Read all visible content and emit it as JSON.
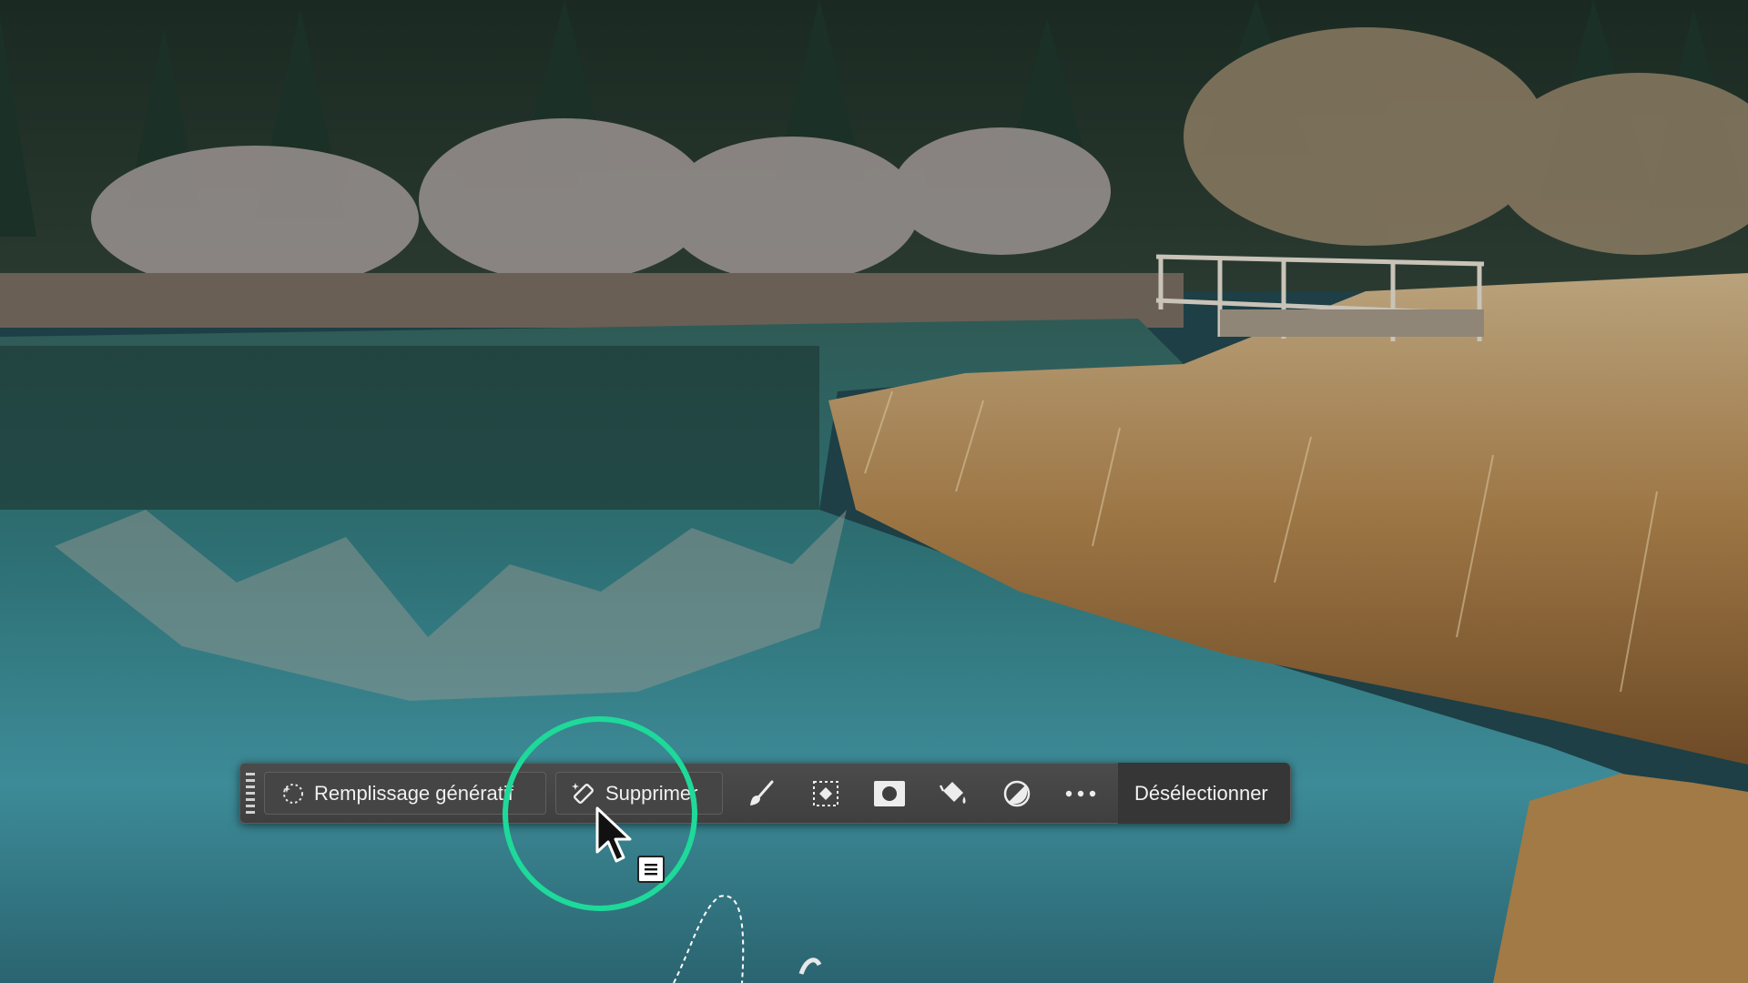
{
  "taskbar": {
    "generative_fill_label": "Remplissage génératif",
    "remove_label": "Supprimer",
    "deselect_label": "Désélectionner"
  },
  "icons": {
    "grip": "grip-handle-icon",
    "generative": "sparkle-circle-icon",
    "remove": "eraser-sparkle-icon",
    "modify": "brush-icon",
    "transform": "selection-transform-icon",
    "mask": "mask-icon",
    "fill": "paint-bucket-icon",
    "adjust": "adjustment-icon",
    "more": "more-options-icon"
  },
  "colors": {
    "highlight_ring": "#1ed99a",
    "taskbar_bg": "#454545",
    "deselect_bg": "#363636"
  }
}
